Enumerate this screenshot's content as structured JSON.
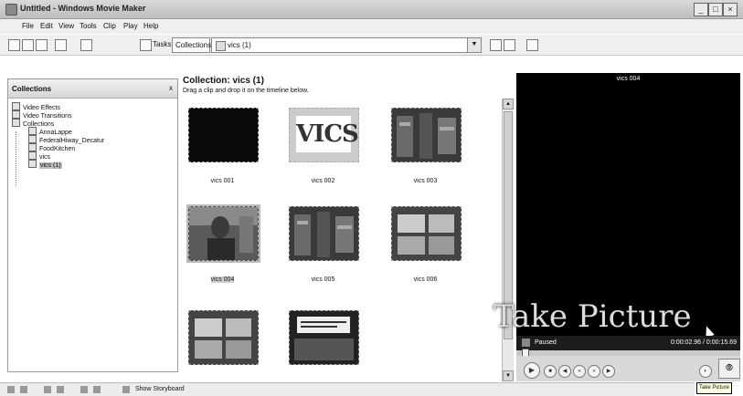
{
  "window": {
    "title": "Untitled - Windows Movie Maker"
  },
  "menu": [
    "File",
    "Edit",
    "View",
    "Tools",
    "Clip",
    "Play",
    "Help"
  ],
  "toolbar": {
    "tasks_label": "Tasks",
    "collections_label": "Collections",
    "combo_value": "vics (1)"
  },
  "collections_pane": {
    "title": "Collections",
    "close_glyph": "x",
    "tree": [
      {
        "label": "Video Effects",
        "level": 0
      },
      {
        "label": "Video Transitions",
        "level": 0
      },
      {
        "label": "Collections",
        "level": 0
      },
      {
        "label": "AnnaLappe",
        "level": 1
      },
      {
        "label": "FederalHiway_Decatur",
        "level": 1
      },
      {
        "label": "FoodKitchen",
        "level": 1
      },
      {
        "label": "vics",
        "level": 1
      },
      {
        "label": "vics (1)",
        "level": 1,
        "selected": true
      }
    ]
  },
  "content": {
    "title": "Collection: vics (1)",
    "subtitle": "Drag a clip and drop it on the timeline below.",
    "clips": [
      {
        "label": "vics 001",
        "kind": "black"
      },
      {
        "label": "vics 002",
        "kind": "logo",
        "logo_text": "VICS"
      },
      {
        "label": "vics 003",
        "kind": "store"
      },
      {
        "label": "vics 004",
        "kind": "person",
        "selected": true
      },
      {
        "label": "vics 005",
        "kind": "store"
      },
      {
        "label": "vics 006",
        "kind": "boxes"
      },
      {
        "label": "",
        "kind": "boxes"
      },
      {
        "label": "",
        "kind": "sign"
      }
    ]
  },
  "preview": {
    "title": "vics 004",
    "caption": "Take Picture",
    "status": "Paused",
    "time": "0:00:02.96 / 0:00:15.69",
    "tooltip": "Take Picture"
  },
  "bottom": {
    "storyboard_label": "Show Storyboard"
  },
  "colors": {
    "preview_bg": "#000000",
    "selection": "#bdbdbd",
    "tooltip_bg": "#ffffe1"
  }
}
